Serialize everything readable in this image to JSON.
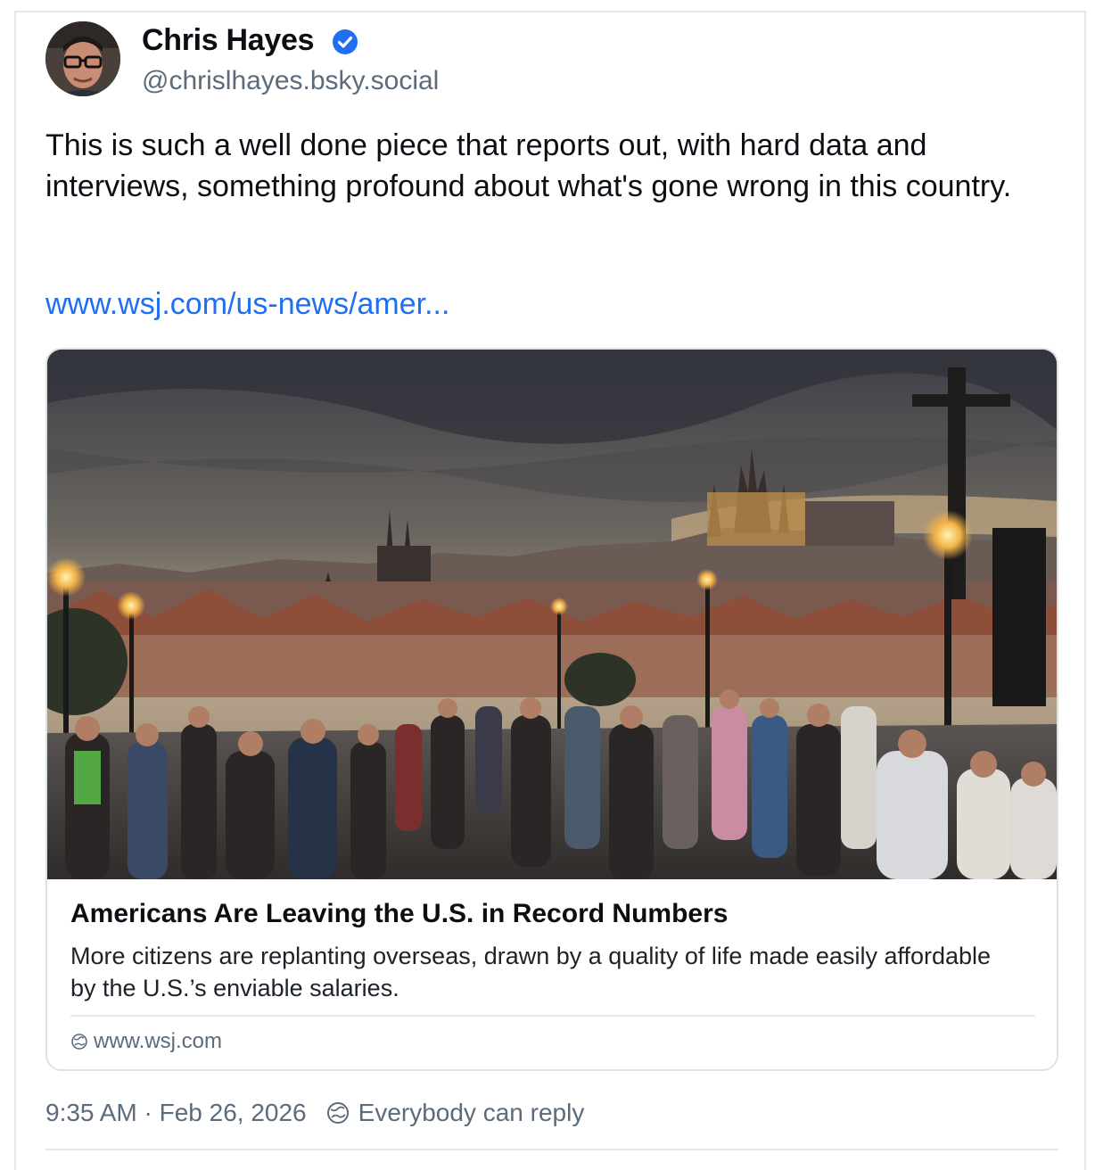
{
  "post": {
    "author": {
      "display_name": "Chris Hayes",
      "handle": "@chrislhayes.bsky.social",
      "verified": true,
      "verified_color": "#1f6ff0"
    },
    "text": "This is such a well done piece that reports out, with hard data and interviews, something profound about what's gone wrong in this country.",
    "link_text": "www.wsj.com/us-news/amer...",
    "link_color": "#1f6ff0",
    "embed": {
      "image_description_icon": "photo",
      "title": "Americans Are Leaving the U.S. in Record Numbers",
      "description": "More citizens are replanting overseas, drawn by a quality of life made easily affordable by the U.S.’s enviable salaries.",
      "domain": "www.wsj.com",
      "domain_icon": "globe-icon"
    },
    "timestamp": "9:35 AM · Feb 26, 2026",
    "reply_setting": "Everybody can reply",
    "reply_icon": "globe-icon"
  }
}
